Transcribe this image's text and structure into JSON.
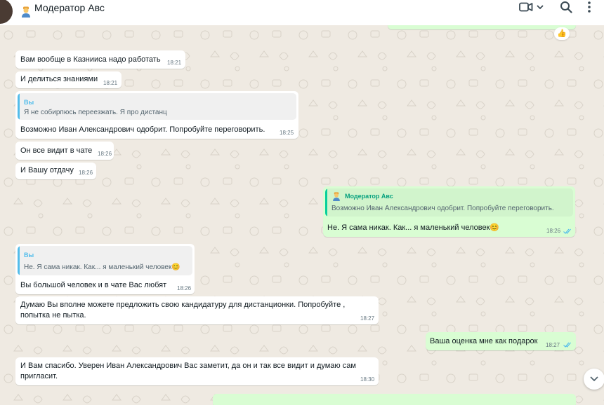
{
  "header": {
    "title": "Модератор Авс"
  },
  "reaction": "👍",
  "messages": {
    "m1": {
      "text": "Вам вообще в Казниисa надо работать",
      "time": "18:21"
    },
    "m2": {
      "text": "И делиться знаниями",
      "time": "18:21"
    },
    "m3": {
      "quote_name": "Вы",
      "quote_text": "Я не собирпюсь переезжать. Я про дистанц",
      "text": "Возможно Иван Александрович одобрит. Попробуйте переговорить.",
      "time": "18:25"
    },
    "m4": {
      "text": "Он все видит в чате",
      "time": "18:26"
    },
    "m5": {
      "text": "И Вашу отдачу",
      "time": "18:26"
    },
    "m6": {
      "quote_name": "Модератор Авс",
      "quote_text": "Возможно Иван Александрович одобрит. Попробуйте переговорить.",
      "text": "Не. Я сама никак. Как... я маленький человек😊",
      "time": "18:26"
    },
    "m7": {
      "quote_name": "Вы",
      "quote_text": "Не. Я сама никак. Как... я маленький человек😊",
      "text": "Вы большой человек и в чате Вас любят",
      "time": "18:26"
    },
    "m8": {
      "text": "Думаю Вы вполне можете предложить свою кандидатуру для дистанционки. Попробуйте , попытка не пытка.",
      "time": "18:27"
    },
    "m9": {
      "text": "Ваша оценка мне как подарок",
      "time": "18:27"
    },
    "m10": {
      "text": "И Вам спасибо. Уверен Иван Александрович Вас заметит, да он и так все видит и думаю сам пригласит.",
      "time": "18:30"
    }
  },
  "colors": {
    "incoming_bubble": "#ffffff",
    "outgoing_bubble": "#d9fdd3",
    "quote_self_bar": "#53bdeb",
    "quote_other_bar": "#06cf9c",
    "read_ticks": "#53bdeb",
    "chat_background": "#efeae2"
  },
  "icons": [
    "video-call-icon",
    "chevron-down-icon",
    "search-icon",
    "menu-icon",
    "scroll-down-icon",
    "double-check-icon"
  ]
}
